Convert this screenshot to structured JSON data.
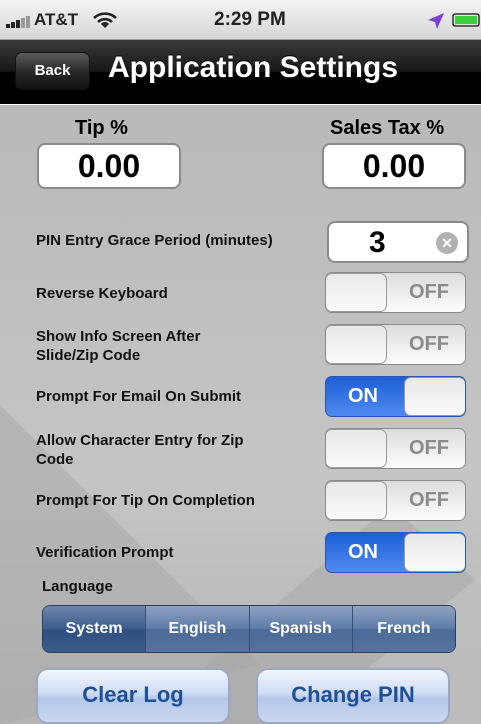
{
  "status_bar": {
    "carrier": "AT&T",
    "time": "2:29 PM",
    "battery_color": "#3bd13b"
  },
  "nav": {
    "back_label": "Back",
    "title": "Application Settings"
  },
  "tip": {
    "label": "Tip %",
    "value": "0.00"
  },
  "sales_tax": {
    "label": "Sales Tax %",
    "value": "0.00"
  },
  "pin_grace": {
    "label": "PIN Entry Grace Period (minutes)",
    "value": "3"
  },
  "settings": [
    {
      "label_line1": "Reverse Keyboard",
      "label_line2": "",
      "state": "OFF"
    },
    {
      "label_line1": "Show Info Screen After",
      "label_line2": "Slide/Zip Code",
      "state": "OFF"
    },
    {
      "label_line1": "Prompt For Email On Submit",
      "label_line2": "",
      "state": "ON"
    },
    {
      "label_line1": "Allow Character Entry for Zip",
      "label_line2": "Code",
      "state": "OFF"
    },
    {
      "label_line1": "Prompt For Tip On Completion",
      "label_line2": "",
      "state": "OFF"
    },
    {
      "label_line1": "Verification Prompt",
      "label_line2": "",
      "state": "ON"
    }
  ],
  "language": {
    "label": "Language",
    "options": [
      "System",
      "English",
      "Spanish",
      "French"
    ],
    "selected": "System"
  },
  "buttons": {
    "clear_log": "Clear Log",
    "change_pin": "Change PIN"
  },
  "colors": {
    "switch_on": "#2d6be0",
    "segment_selected": "#3c5c8d",
    "button_text": "#1e4f99"
  }
}
